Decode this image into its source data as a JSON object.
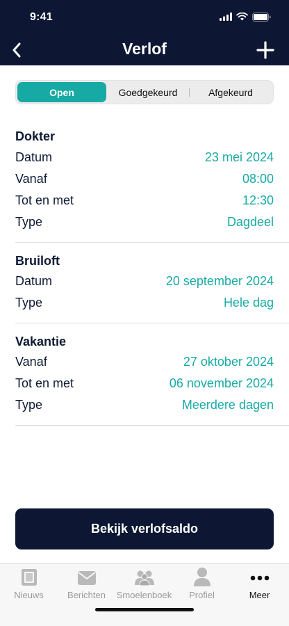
{
  "status": {
    "time": "9:41"
  },
  "nav": {
    "title": "Verlof"
  },
  "tabs": {
    "open": "Open",
    "approved": "Goedgekeurd",
    "rejected": "Afgekeurd"
  },
  "cards": [
    {
      "title": "Dokter",
      "rows": [
        {
          "label": "Datum",
          "value": "23 mei 2024"
        },
        {
          "label": "Vanaf",
          "value": "08:00"
        },
        {
          "label": "Tot en met",
          "value": "12:30"
        },
        {
          "label": "Type",
          "value": "Dagdeel"
        }
      ]
    },
    {
      "title": "Bruiloft",
      "rows": [
        {
          "label": "Datum",
          "value": "20 september 2024"
        },
        {
          "label": "Type",
          "value": "Hele dag"
        }
      ]
    },
    {
      "title": "Vakantie",
      "rows": [
        {
          "label": "Vanaf",
          "value": "27 oktober 2024"
        },
        {
          "label": "Tot en met",
          "value": "06 november 2024"
        },
        {
          "label": "Type",
          "value": "Meerdere dagen"
        }
      ]
    }
  ],
  "cta": {
    "label": "Bekijk verlofsaldo"
  },
  "bottom_nav": [
    {
      "label": "Nieuws",
      "icon": "newspaper-icon"
    },
    {
      "label": "Berichten",
      "icon": "envelope-icon"
    },
    {
      "label": "Smoelenboek",
      "icon": "people-icon"
    },
    {
      "label": "Profiel",
      "icon": "person-icon"
    },
    {
      "label": "Meer",
      "icon": "more-dots-icon",
      "active": true
    }
  ],
  "colors": {
    "navy": "#0d1733",
    "teal": "#17aaa5"
  }
}
